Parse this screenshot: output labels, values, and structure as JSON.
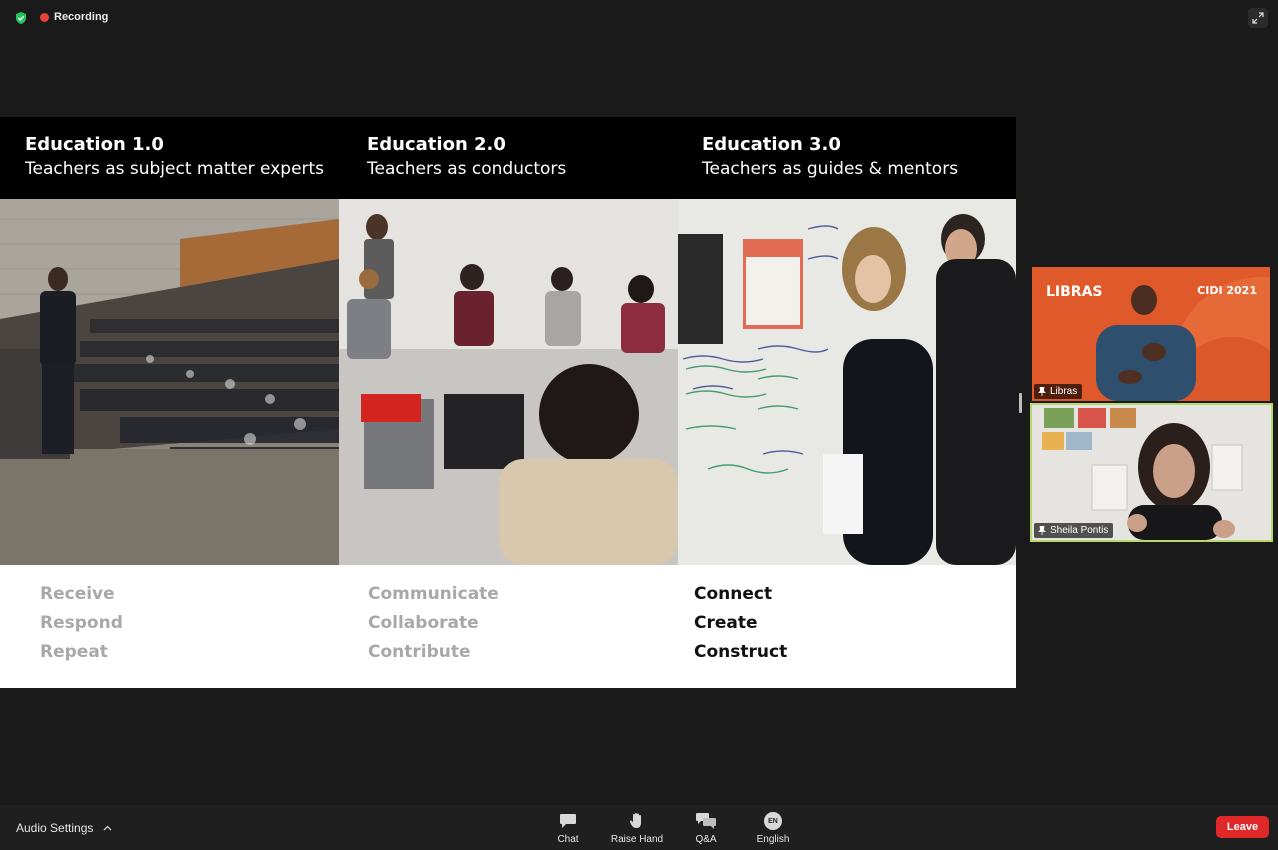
{
  "topbar": {
    "recording_label": "Recording",
    "shield_color": "#23c55e",
    "recording_color": "#e8413c"
  },
  "slide": {
    "columns": [
      {
        "title": "Education 1.0",
        "subtitle": "Teachers as subject matter experts",
        "words": [
          "Receive",
          "Respond",
          "Repeat"
        ],
        "highlighted": false
      },
      {
        "title": "Education 2.0",
        "subtitle": "Teachers as conductors",
        "words": [
          "Communicate",
          "Collaborate",
          "Contribute"
        ],
        "highlighted": false
      },
      {
        "title": "Education 3.0",
        "subtitle": "Teachers as guides & mentors",
        "words": [
          "Connect",
          "Create",
          "Construct"
        ],
        "highlighted": true
      }
    ]
  },
  "participants": [
    {
      "name": "Libras",
      "overlay_left": "LIBRAS",
      "overlay_right": "CIDI 2021",
      "bg_color": "#e0592a"
    },
    {
      "name": "Sheila Pontis",
      "active_speaker": true,
      "highlight_color": "#b8d86b"
    }
  ],
  "bottombar": {
    "audio_settings_label": "Audio Settings",
    "tools": [
      {
        "label": "Chat",
        "icon": "chat-icon"
      },
      {
        "label": "Raise Hand",
        "icon": "hand-icon"
      },
      {
        "label": "Q&A",
        "icon": "qa-icon"
      },
      {
        "label": "English",
        "icon": "language-icon",
        "badge": "EN"
      }
    ],
    "leave_label": "Leave",
    "leave_color": "#e02828"
  }
}
